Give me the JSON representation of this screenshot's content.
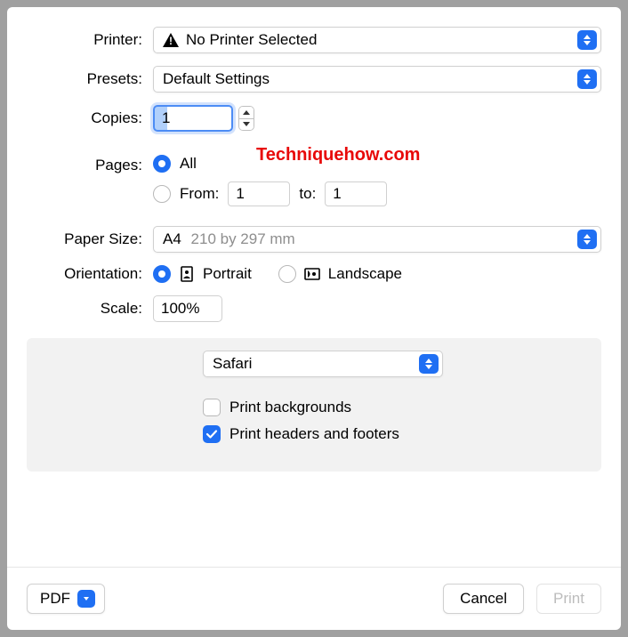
{
  "labels": {
    "printer": "Printer:",
    "presets": "Presets:",
    "copies": "Copies:",
    "pages": "Pages:",
    "paper_size": "Paper Size:",
    "orientation": "Orientation:",
    "scale": "Scale:"
  },
  "printer": {
    "value": "No Printer Selected"
  },
  "presets": {
    "value": "Default Settings"
  },
  "copies": {
    "value": "1"
  },
  "pages": {
    "all_label": "All",
    "from_label": "From:",
    "to_label": "to:",
    "from_value": "1",
    "to_value": "1",
    "selected": "all"
  },
  "paper_size": {
    "name": "A4",
    "dims": "210 by 297 mm"
  },
  "orientation": {
    "portrait_label": "Portrait",
    "landscape_label": "Landscape",
    "selected": "portrait"
  },
  "scale": {
    "value": "100%"
  },
  "panel": {
    "app": "Safari",
    "print_backgrounds_label": "Print backgrounds",
    "print_headers_footers_label": "Print headers and footers",
    "print_backgrounds_checked": false,
    "print_headers_footers_checked": true
  },
  "footer": {
    "pdf_label": "PDF",
    "cancel_label": "Cancel",
    "print_label": "Print"
  },
  "watermark": "Techniquehow.com"
}
